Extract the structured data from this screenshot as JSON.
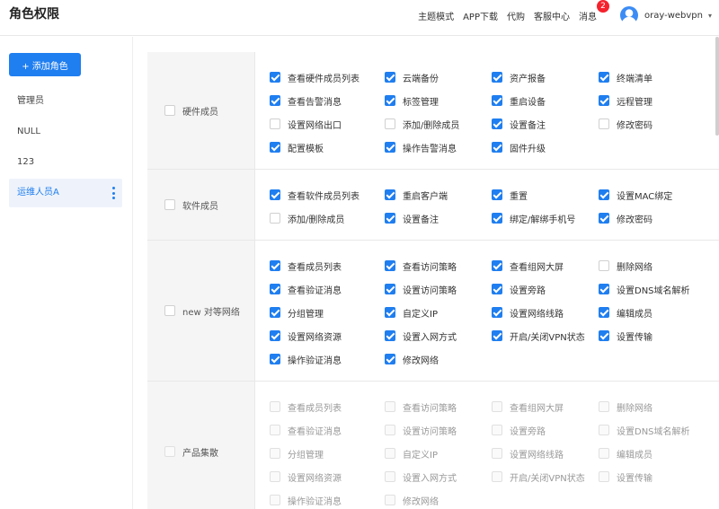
{
  "page_title": "角色权限",
  "nav": {
    "theme": "主题模式",
    "app_download": "APP下载",
    "purchase": "代购",
    "support": "客服中心",
    "messages": "消息",
    "message_count": "2",
    "username": "oray-webvpn"
  },
  "sidebar": {
    "add_button": "+ 添加角色",
    "roles": [
      "管理员",
      "NULL",
      "123",
      "运维人员A"
    ],
    "active_role": "运维人员A"
  },
  "colors": {
    "accent": "#1f7ef0",
    "badge": "#f5222d",
    "header_bg": "#f5f5f5"
  },
  "groups": [
    {
      "name": "硬件成员",
      "checked": false,
      "perms": [
        {
          "label": "查看硬件成员列表",
          "checked": true
        },
        {
          "label": "云端备份",
          "checked": true
        },
        {
          "label": "资产报备",
          "checked": true
        },
        {
          "label": "终端清单",
          "checked": true
        },
        {
          "label": "查看告警消息",
          "checked": true
        },
        {
          "label": "标签管理",
          "checked": true
        },
        {
          "label": "重启设备",
          "checked": true
        },
        {
          "label": "远程管理",
          "checked": true
        },
        {
          "label": "设置网络出口",
          "checked": false
        },
        {
          "label": "添加/删除成员",
          "checked": false
        },
        {
          "label": "设置备注",
          "checked": true
        },
        {
          "label": "修改密码",
          "checked": false
        },
        {
          "label": "配置模板",
          "checked": true
        },
        {
          "label": "操作告警消息",
          "checked": true
        },
        {
          "label": "固件升级",
          "checked": true
        }
      ]
    },
    {
      "name": "软件成员",
      "checked": false,
      "perms": [
        {
          "label": "查看软件成员列表",
          "checked": true
        },
        {
          "label": "重启客户端",
          "checked": true
        },
        {
          "label": "重置",
          "checked": true
        },
        {
          "label": "设置MAC绑定",
          "checked": true
        },
        {
          "label": "添加/删除成员",
          "checked": false
        },
        {
          "label": "设置备注",
          "checked": true
        },
        {
          "label": "绑定/解绑手机号",
          "checked": true
        },
        {
          "label": "修改密码",
          "checked": true
        }
      ]
    },
    {
      "name": "new 对等网络",
      "checked": false,
      "perms": [
        {
          "label": "查看成员列表",
          "checked": true
        },
        {
          "label": "查看访问策略",
          "checked": true
        },
        {
          "label": "查看组网大屏",
          "checked": true
        },
        {
          "label": "删除网络",
          "checked": false
        },
        {
          "label": "查看验证消息",
          "checked": true
        },
        {
          "label": "设置访问策略",
          "checked": true
        },
        {
          "label": "设置旁路",
          "checked": true
        },
        {
          "label": "设置DNS域名解析",
          "checked": true
        },
        {
          "label": "分组管理",
          "checked": true
        },
        {
          "label": "自定义IP",
          "checked": true
        },
        {
          "label": "设置网络线路",
          "checked": true
        },
        {
          "label": "编辑成员",
          "checked": true
        },
        {
          "label": "设置网络资源",
          "checked": true
        },
        {
          "label": "设置入网方式",
          "checked": true
        },
        {
          "label": "开启/关闭VPN状态",
          "checked": true
        },
        {
          "label": "设置传输",
          "checked": true
        },
        {
          "label": "操作验证消息",
          "checked": true
        },
        {
          "label": "修改网络",
          "checked": true
        }
      ]
    },
    {
      "name": "产品集散",
      "checked": false,
      "disabled": true,
      "perms": [
        {
          "label": "查看成员列表",
          "checked": false
        },
        {
          "label": "查看访问策略",
          "checked": false
        },
        {
          "label": "查看组网大屏",
          "checked": false
        },
        {
          "label": "删除网络",
          "checked": false
        },
        {
          "label": "查看验证消息",
          "checked": false
        },
        {
          "label": "设置访问策略",
          "checked": false
        },
        {
          "label": "设置旁路",
          "checked": false
        },
        {
          "label": "设置DNS域名解析",
          "checked": false
        },
        {
          "label": "分组管理",
          "checked": false
        },
        {
          "label": "自定义IP",
          "checked": false
        },
        {
          "label": "设置网络线路",
          "checked": false
        },
        {
          "label": "编辑成员",
          "checked": false
        },
        {
          "label": "设置网络资源",
          "checked": false
        },
        {
          "label": "设置入网方式",
          "checked": false
        },
        {
          "label": "开启/关闭VPN状态",
          "checked": false
        },
        {
          "label": "设置传输",
          "checked": false
        },
        {
          "label": "操作验证消息",
          "checked": false
        },
        {
          "label": "修改网络",
          "checked": false
        }
      ]
    }
  ]
}
